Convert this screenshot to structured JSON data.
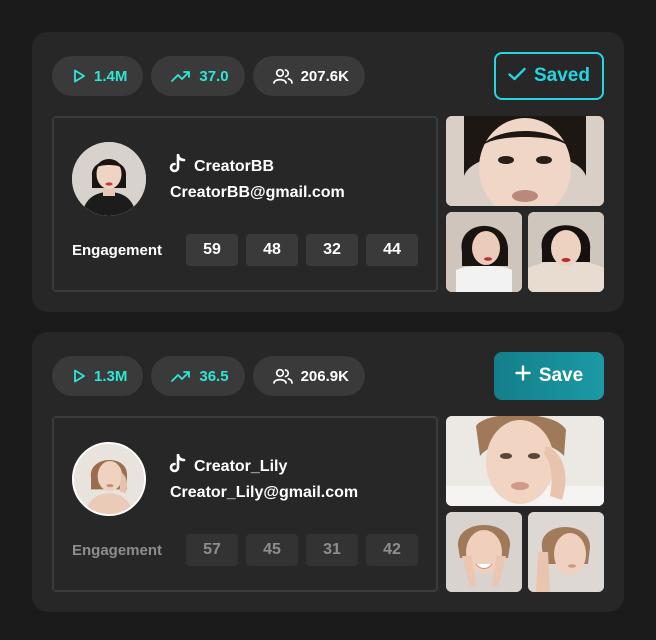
{
  "creators": [
    {
      "stats": {
        "views": "1.4M",
        "rate": "37.0",
        "followers": "207.6K"
      },
      "save_label": "Saved",
      "saved": true,
      "handle": "CreatorBB",
      "email": "CreatorBB@gmail.com",
      "engagement_label": "Engagement",
      "engagement": [
        "59",
        "48",
        "32",
        "44"
      ],
      "icons": {
        "views": "play-icon",
        "rate": "trend-up-icon",
        "followers": "users-icon",
        "platform": "tiktok-icon",
        "save": "check-icon"
      }
    },
    {
      "stats": {
        "views": "1.3M",
        "rate": "36.5",
        "followers": "206.9K"
      },
      "save_label": "Save",
      "saved": false,
      "handle": "Creator_Lily",
      "email": "Creator_Lily@gmail.com",
      "engagement_label": "Engagement",
      "engagement": [
        "57",
        "45",
        "31",
        "42"
      ],
      "icons": {
        "views": "play-icon",
        "rate": "trend-up-icon",
        "followers": "users-icon",
        "platform": "tiktok-icon",
        "save": "plus-icon"
      }
    }
  ],
  "colors": {
    "background": "#1b1b1b",
    "card": "#272727",
    "chip": "#3a3a3a",
    "accent": "#2ee6d6",
    "saved_border": "#27d4e3",
    "save_button": "#1b9aa6"
  }
}
